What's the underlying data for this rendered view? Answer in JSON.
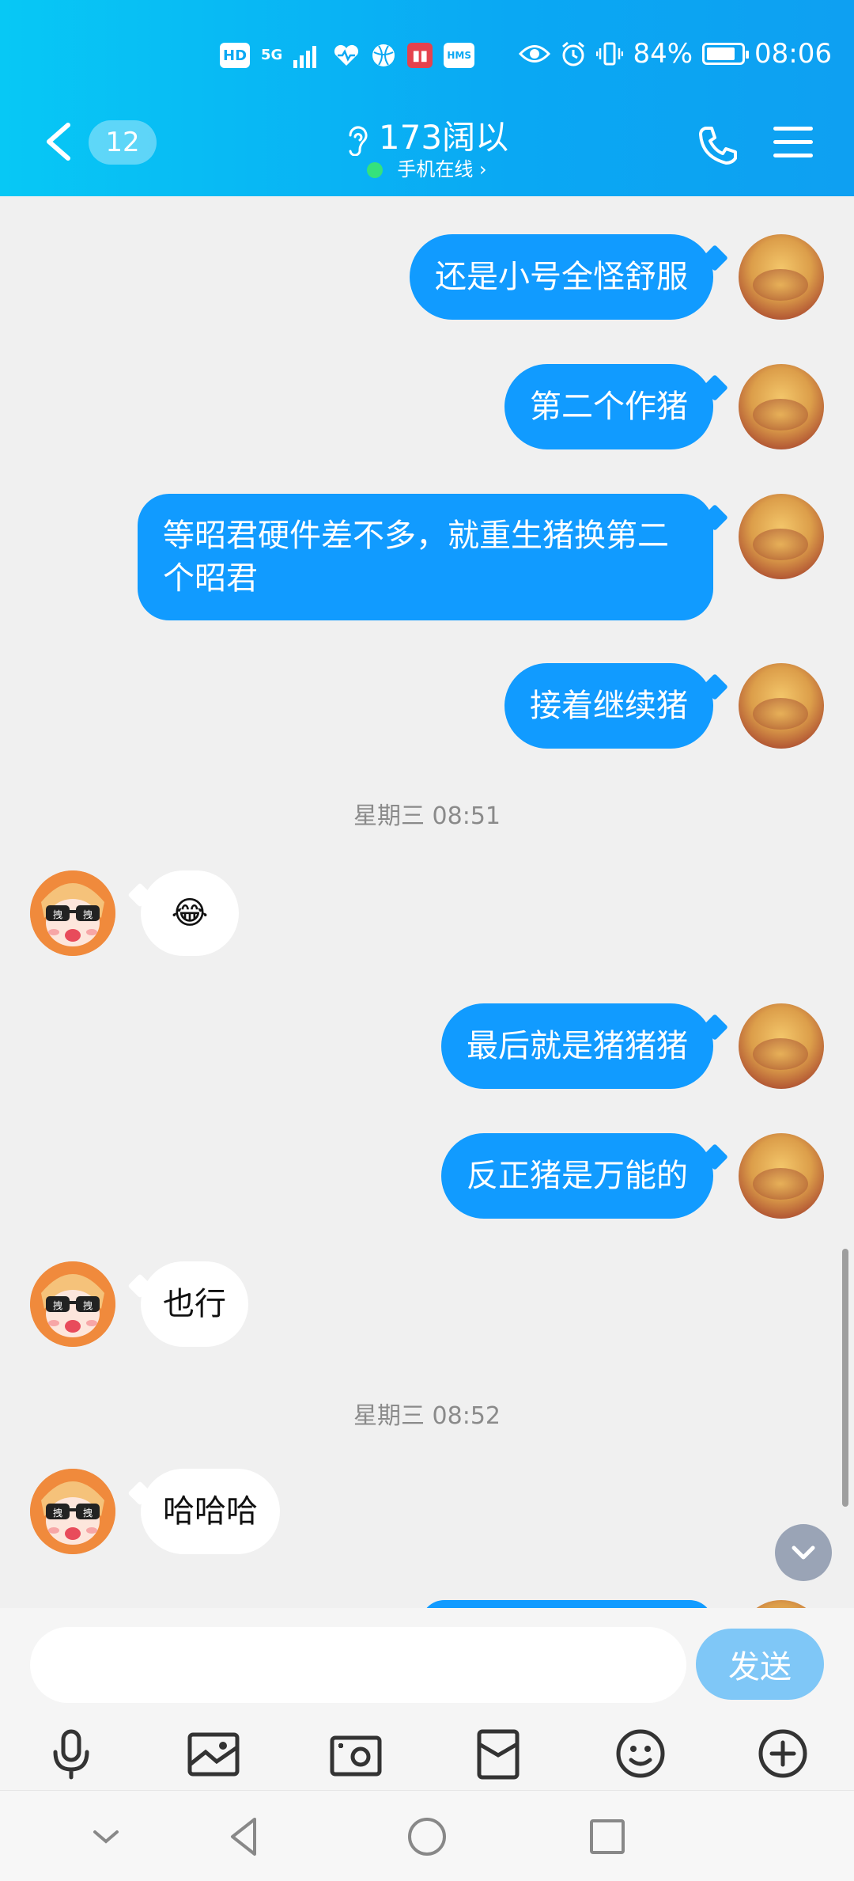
{
  "status_bar": {
    "left_icons": [
      "HD",
      "5G",
      "signal-icon",
      "heart-rate-icon",
      "browser-icon",
      "book-app-icon",
      "HMS"
    ],
    "battery": "84%",
    "battery_level": 0.84,
    "time": "08:06"
  },
  "header": {
    "unread_count": "12",
    "contact_name": "173阔以",
    "status_text": "手机在线 ›"
  },
  "messages": [
    {
      "side": "out",
      "text": "还是小号全怪舒服"
    },
    {
      "side": "out",
      "text": "第二个作猪"
    },
    {
      "side": "out",
      "text": "等昭君硬件差不多，就重生猪换第二个昭君"
    },
    {
      "side": "out",
      "text": "接着继续猪"
    },
    {
      "type": "time",
      "text": "星期三 08:51"
    },
    {
      "side": "in",
      "text": "😂"
    },
    {
      "side": "out",
      "text": "最后就是猪猪猪"
    },
    {
      "side": "out",
      "text": "反正猪是万能的"
    },
    {
      "side": "in",
      "text": "也行"
    },
    {
      "type": "time",
      "text": "星期三 08:52"
    },
    {
      "side": "in",
      "text": "哈哈哈"
    }
  ],
  "avatar_badge_left": "拽",
  "avatar_badge_right": "拽",
  "input": {
    "placeholder": "",
    "value": ""
  },
  "send_label": "发送",
  "toolbar_icons": [
    "microphone-icon",
    "image-icon",
    "camera-icon",
    "red-packet-icon",
    "emoji-icon",
    "plus-icon"
  ],
  "nav_icons": [
    "hide-keyboard-icon",
    "back-triangle-icon",
    "home-circle-icon",
    "recents-square-icon"
  ],
  "colors": {
    "header": "#0aa8f3",
    "outgoing_bubble": "#119bff",
    "send_button": "#7fc7f7",
    "background": "#f0f0f0"
  }
}
